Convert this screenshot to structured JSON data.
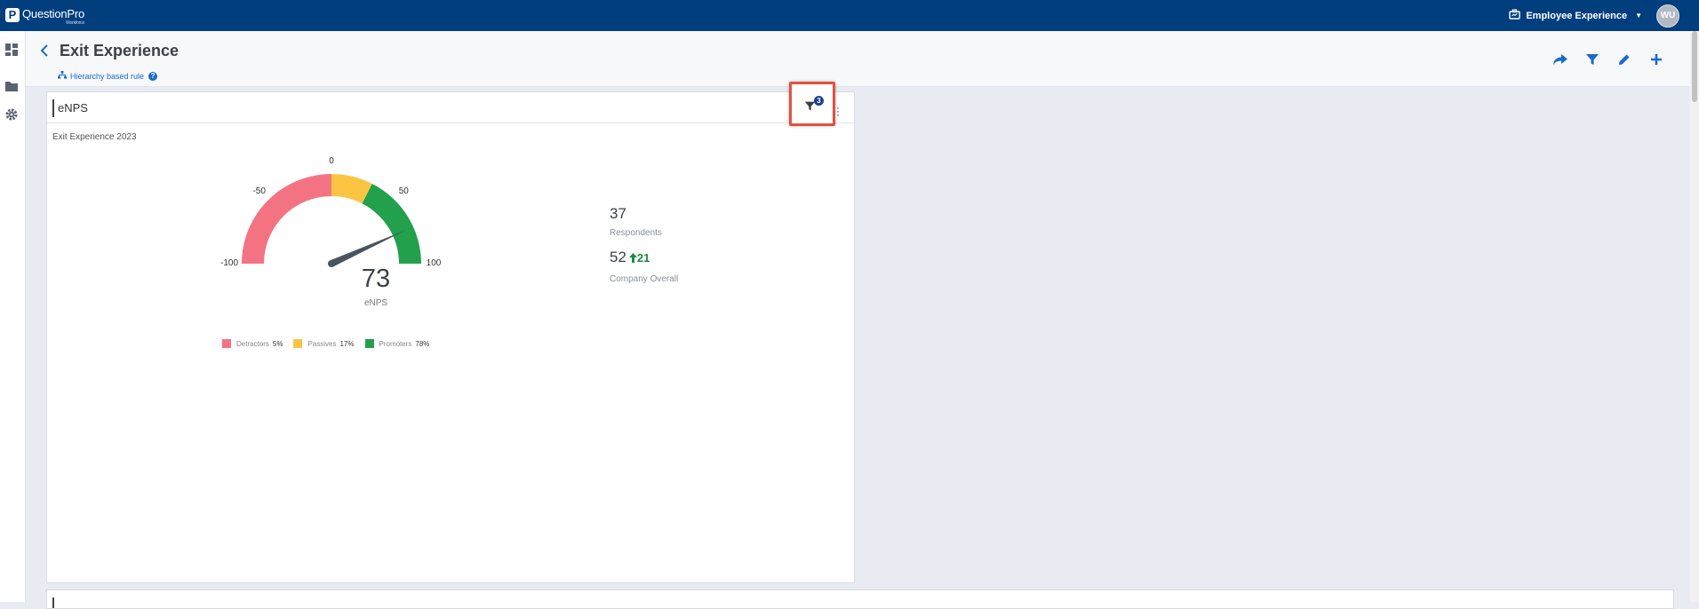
{
  "topbar": {
    "logo_mark": "P",
    "logo_text": "QuestionPro",
    "logo_sub": "Workforce",
    "product": "Employee Experience",
    "avatar": "WU"
  },
  "header": {
    "title": "Exit Experience",
    "rule": "Hierarchy based rule",
    "help": "?"
  },
  "card": {
    "title": "eNPS",
    "filter_count": "3",
    "subtitle": "Exit Experience 2023",
    "respondents": {
      "value": "37",
      "label": "Respondents"
    },
    "company": {
      "value": "52",
      "delta": "21",
      "label": "Company Overall"
    }
  },
  "chart_data": {
    "type": "gauge",
    "value": 73,
    "value_label": "eNPS",
    "range": [
      -100,
      100
    ],
    "ticks": [
      "-100",
      "-50",
      "0",
      "50",
      "100"
    ],
    "segments": [
      {
        "name": "Detractors",
        "from": -100,
        "to": 0,
        "color": "#f47382"
      },
      {
        "name": "Passives",
        "from": 0,
        "to": 30,
        "color": "#fbc543"
      },
      {
        "name": "Promoters",
        "from": 30,
        "to": 100,
        "color": "#22a04b"
      }
    ],
    "legend": [
      {
        "name": "Detractors",
        "pct": "5%",
        "color": "#f47382"
      },
      {
        "name": "Passives",
        "pct": "17%",
        "color": "#fbc543"
      },
      {
        "name": "Promoters",
        "pct": "78%",
        "color": "#22a04b"
      }
    ]
  }
}
